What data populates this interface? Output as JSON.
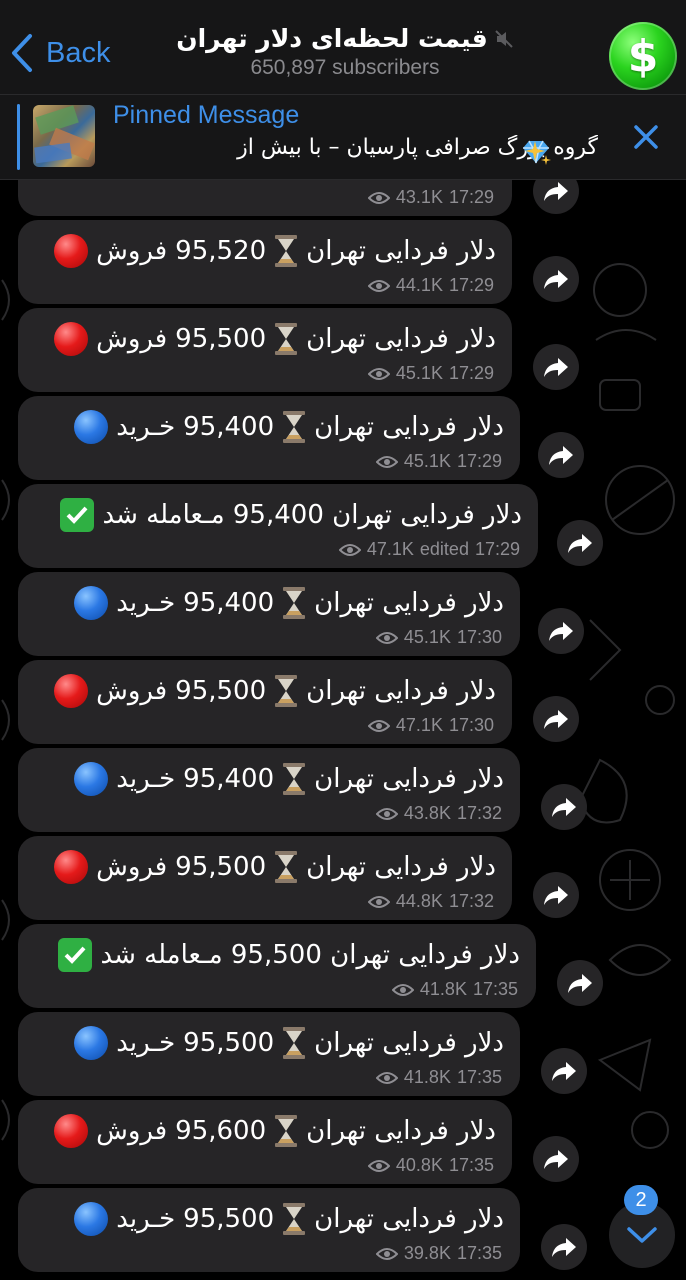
{
  "header": {
    "back_label": "Back",
    "title": "قیمت لحظه‌ای دلار تهران",
    "subscribers": "650,897 subscribers",
    "avatar_glyph": "$"
  },
  "pinned": {
    "label": "Pinned Message",
    "text": "گروه بزرگ صرافی پارسیان – با بیش از"
  },
  "colors": {
    "accent": "#3e8fe8",
    "bubble": "#262527",
    "meta": "#8f8e93"
  },
  "messages": [
    {
      "text": "",
      "views": "43.1K",
      "time": "17:29"
    },
    {
      "text": "دلار فردایی تهران",
      "price": "95,520",
      "action": "فروش",
      "marker": "red-circle",
      "views": "44.1K",
      "time": "17:29"
    },
    {
      "text": "دلار فردایی تهران",
      "price": "95,500",
      "action": "فروش",
      "marker": "red-circle",
      "views": "45.1K",
      "time": "17:29"
    },
    {
      "text": "دلار فردایی تهران",
      "price": "95,400",
      "action": "خـرید",
      "marker": "blue-circle",
      "views": "45.1K",
      "time": "17:29"
    },
    {
      "text": "دلار فردایی تهران 95,400 مـعامله شد",
      "marker": "check-mark",
      "views": "47.1K",
      "edited": "edited",
      "time": "17:29"
    },
    {
      "text": "دلار فردایی تهران",
      "price": "95,400",
      "action": "خـرید",
      "marker": "blue-circle",
      "views": "45.1K",
      "time": "17:30"
    },
    {
      "text": "دلار فردایی تهران",
      "price": "95,500",
      "action": "فروش",
      "marker": "red-circle",
      "views": "47.1K",
      "time": "17:30"
    },
    {
      "text": "دلار فردایی تهران",
      "price": "95,400",
      "action": "خـرید",
      "marker": "blue-circle",
      "views": "43.8K",
      "time": "17:32"
    },
    {
      "text": "دلار فردایی تهران",
      "price": "95,500",
      "action": "فروش",
      "marker": "red-circle",
      "views": "44.8K",
      "time": "17:32"
    },
    {
      "text": "دلار فردایی تهران 95,500 مـعامله شد",
      "marker": "check-mark",
      "views": "41.8K",
      "time": "17:35"
    },
    {
      "text": "دلار فردایی تهران",
      "price": "95,500",
      "action": "خـرید",
      "marker": "blue-circle",
      "views": "41.8K",
      "time": "17:35"
    },
    {
      "text": "دلار فردایی تهران",
      "price": "95,600",
      "action": "فروش",
      "marker": "red-circle",
      "views": "40.8K",
      "time": "17:35"
    },
    {
      "text": "دلار فردایی تهران",
      "price": "95,500",
      "action": "خـرید",
      "marker": "blue-circle",
      "views": "39.8K",
      "time": "17:35"
    }
  ],
  "scroll": {
    "unread_count": "2"
  }
}
